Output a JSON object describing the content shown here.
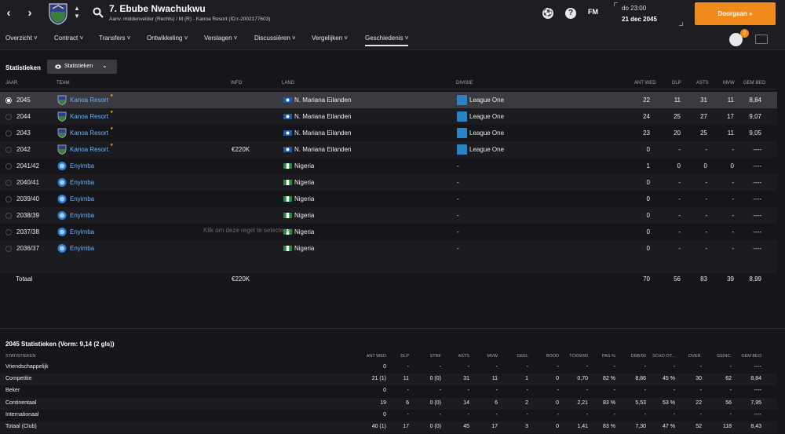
{
  "header": {
    "back_label": "‹",
    "forward_label": "›",
    "player_name": "7. Ebube Nwachukwu",
    "player_sub": "Aanv. middenvelder (Rechts) / M (R) - Kanoa Resort (ID:r-2002177603)",
    "fm_label": "FM",
    "time": "do 23:00",
    "date": "21 dec 2045",
    "continue_label": "Doorgaan  »",
    "notification_count": "2",
    "colors": {
      "accent": "#f08a1c",
      "link": "#66b4ff",
      "highlight_row": "#3a3a41"
    }
  },
  "tabs": [
    {
      "label": "Overzicht ˅"
    },
    {
      "label": "Contract ˅"
    },
    {
      "label": "Transfers ˅"
    },
    {
      "label": "Ontwikkeling ˅"
    },
    {
      "label": "Verslagen ˅"
    },
    {
      "label": "Discussiëren ˅"
    },
    {
      "label": "Vergelijken ˅"
    },
    {
      "label": "Geschiedenis ˅"
    }
  ],
  "section": {
    "title": "Statistieken",
    "dropdown_label": "Statistieken",
    "dropdown_icon": "eye-icon"
  },
  "history": {
    "columns": [
      "JAAR",
      "TEAM",
      "INFO",
      "LAND",
      "DIVISIE",
      "ANT WED",
      "DLP",
      "ASTS",
      "MVW",
      "GEM BEO"
    ],
    "rows": [
      {
        "year": "2045",
        "team": "Kanoa Resort",
        "info": "",
        "country": "N. Mariana Eilanden",
        "division": "League One",
        "apps": "22",
        "goals": "11",
        "assists": "31",
        "mom": "11",
        "rating": "8,84"
      },
      {
        "year": "2044",
        "team": "Kanoa Resort",
        "info": "",
        "country": "N. Mariana Eilanden",
        "division": "League One",
        "apps": "24",
        "goals": "25",
        "assists": "27",
        "mom": "17",
        "rating": "9,07"
      },
      {
        "year": "2043",
        "team": "Kanoa Resort",
        "info": "",
        "country": "N. Mariana Eilanden",
        "division": "League One",
        "apps": "23",
        "goals": "20",
        "assists": "25",
        "mom": "11",
        "rating": "9,05"
      },
      {
        "year": "2042",
        "team": "Kanoa Resort",
        "info": "€220K",
        "country": "N. Mariana Eilanden",
        "division": "League One",
        "apps": "0",
        "goals": "-",
        "assists": "-",
        "mom": "-",
        "rating": "----"
      },
      {
        "year": "2041/42",
        "team": "Enyimba",
        "info": "",
        "country": "Nigeria",
        "division": "-",
        "apps": "1",
        "goals": "0",
        "assists": "0",
        "mom": "0",
        "rating": "----"
      },
      {
        "year": "2040/41",
        "team": "Enyimba",
        "info": "",
        "country": "Nigeria",
        "division": "-",
        "apps": "0",
        "goals": "-",
        "assists": "-",
        "mom": "-",
        "rating": "----"
      },
      {
        "year": "2039/40",
        "team": "Enyimba",
        "info": "",
        "country": "Nigeria",
        "division": "-",
        "apps": "0",
        "goals": "-",
        "assists": "-",
        "mom": "-",
        "rating": "----"
      },
      {
        "year": "2038/39",
        "team": "Enyimba",
        "info": "",
        "country": "Nigeria",
        "division": "-",
        "apps": "0",
        "goals": "-",
        "assists": "-",
        "mom": "-",
        "rating": "----"
      },
      {
        "year": "2037/38",
        "team": "Enyimba",
        "info": "",
        "country": "Nigeria",
        "division": "-",
        "apps": "0",
        "goals": "-",
        "assists": "-",
        "mom": "-",
        "rating": "----"
      },
      {
        "year": "2036/37",
        "team": "Enyimba",
        "info": "",
        "country": "Nigeria",
        "division": "-",
        "apps": "0",
        "goals": "-",
        "assists": "-",
        "mom": "-",
        "rating": "----"
      }
    ],
    "tooltip": "Klik om deze regel te selecteren",
    "total": {
      "label": "Totaal",
      "info": "€220K",
      "apps": "70",
      "goals": "56",
      "assists": "83",
      "mom": "39",
      "rating": "8,99"
    }
  },
  "season": {
    "title": "2045 Statistieken (Vorm: 9,14 (2 gls))",
    "columns": [
      "STATISTIEKEN",
      "ANT WED",
      "DLP",
      "STRF",
      "ASTS",
      "MVW",
      "GEEL",
      "ROOD",
      "TCKW/90",
      "PAS %",
      "DRB/90",
      "SCHO OT...",
      "OVER.",
      "GEINC.",
      "GEM BEO"
    ],
    "rows": [
      {
        "name": "Vriendschappelijk",
        "vals": [
          "0",
          "-",
          "-",
          "-",
          "-",
          "-",
          "-",
          "-",
          "-",
          "-",
          "-",
          "-",
          "-",
          "----"
        ]
      },
      {
        "name": "Competitie",
        "vals": [
          "21 (1)",
          "11",
          "0 (0)",
          "31",
          "11",
          "1",
          "0",
          "0,70",
          "82 %",
          "8,86",
          "45 %",
          "30",
          "62",
          "8,84"
        ]
      },
      {
        "name": "Beker",
        "vals": [
          "0",
          "-",
          "-",
          "-",
          "-",
          "-",
          "-",
          "-",
          "-",
          "-",
          "-",
          "-",
          "-",
          "----"
        ]
      },
      {
        "name": "Continentaal",
        "vals": [
          "19",
          "6",
          "0 (0)",
          "14",
          "6",
          "2",
          "0",
          "2,21",
          "83 %",
          "5,53",
          "53 %",
          "22",
          "56",
          "7,95"
        ]
      },
      {
        "name": "Internationaal",
        "vals": [
          "0",
          "-",
          "-",
          "-",
          "-",
          "-",
          "-",
          "-",
          "-",
          "-",
          "-",
          "-",
          "-",
          "----"
        ]
      },
      {
        "name": "Totaal (Club)",
        "vals": [
          "40 (1)",
          "17",
          "0 (0)",
          "45",
          "17",
          "3",
          "0",
          "1,41",
          "83 %",
          "7,30",
          "47 %",
          "52",
          "118",
          "8,43"
        ]
      }
    ]
  }
}
